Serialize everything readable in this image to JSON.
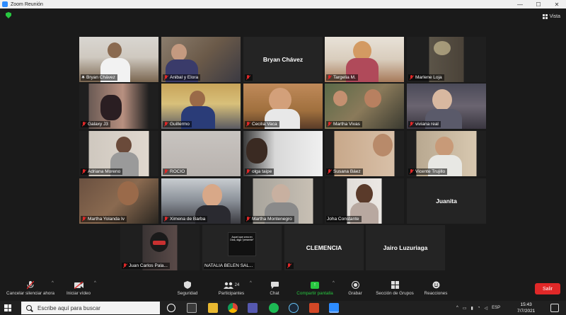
{
  "window": {
    "title": "Zoom Reunión"
  },
  "view_button": {
    "label": "Vista"
  },
  "participants": [
    {
      "name": "Bryan Chávez",
      "pinned": true,
      "muted": false
    },
    {
      "name": "Anibal y Elora",
      "muted": true
    },
    {
      "name": "Bryan Chávez",
      "muted": true,
      "camera_off": true
    },
    {
      "name": "Targelia M.",
      "muted": true
    },
    {
      "name": "Marlene Loja",
      "muted": true
    },
    {
      "name": "Galaxy J3",
      "muted": true
    },
    {
      "name": "Guillermo",
      "muted": true
    },
    {
      "name": "Cecilia Vaca",
      "muted": true
    },
    {
      "name": "Martha Vivas",
      "muted": true
    },
    {
      "name": "viviana real",
      "muted": true
    },
    {
      "name": "Adriana Moreno",
      "muted": true
    },
    {
      "name": "ROCIO",
      "muted": true
    },
    {
      "name": "olga taipe",
      "muted": true
    },
    {
      "name": "Susana Báez",
      "muted": true
    },
    {
      "name": "Vicente Trujillo",
      "muted": true
    },
    {
      "name": "Martha Yolanda Iv",
      "muted": true
    },
    {
      "name": "Ximena de Barba",
      "muted": true
    },
    {
      "name": "Martha Montenegro",
      "muted": true
    },
    {
      "name": "Joha Constante",
      "muted": false,
      "active_speaker": true
    },
    {
      "name": "Juanita",
      "muted": false,
      "camera_off": true
    },
    {
      "name": "Juan Carlos Pala...",
      "muted": true
    },
    {
      "name": "NATALIA BELEN SAL...",
      "muted": false,
      "shared_text": "Aquel que crea en Dios, diga \"presente\""
    },
    {
      "name": "CLEMENCIA",
      "muted": true,
      "camera_off": true
    },
    {
      "name": "Jairo Luzuriaga",
      "muted": false,
      "camera_off": true
    }
  ],
  "toolbar": {
    "unmute_label": "Cancelar silenciar ahora",
    "video_label": "Iniciar vídeo",
    "security_label": "Seguridad",
    "participants_label": "Participantes",
    "participants_count": "24",
    "chat_label": "Chat",
    "share_label": "Compartir pantalla",
    "record_label": "Grabar",
    "breakout_label": "Sección de Grupos",
    "reactions_label": "Reacciones",
    "leave_label": "Salir"
  },
  "taskbar": {
    "search_placeholder": "Escribe aquí para buscar",
    "language": "ESP",
    "time": "15:43",
    "date": "7/7/2021"
  },
  "colors": {
    "accent_green": "#28c840",
    "leave_red": "#e02828",
    "active_speaker": "#c8e85a",
    "muted_red": "#e02828"
  }
}
